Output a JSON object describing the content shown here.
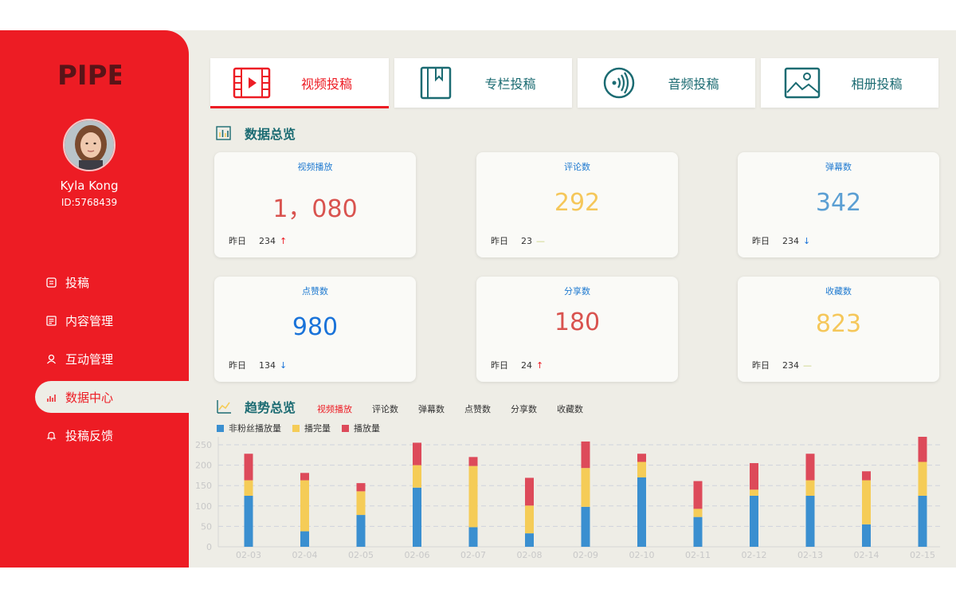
{
  "brand": {
    "logo_text": "PIPE"
  },
  "user": {
    "name": "Kyla Kong",
    "id": "ID:5768439"
  },
  "nav": [
    {
      "label": "投稿",
      "icon": "upload-icon"
    },
    {
      "label": "内容管理",
      "icon": "document-icon"
    },
    {
      "label": "互动管理",
      "icon": "users-icon"
    },
    {
      "label": "数据中心",
      "icon": "chart-icon",
      "active": true
    },
    {
      "label": "投稿反馈",
      "icon": "bell-icon"
    }
  ],
  "tabs": [
    {
      "label": "视频投稿",
      "icon": "film-icon",
      "active": true
    },
    {
      "label": "专栏投稿",
      "icon": "bookmark-book-icon"
    },
    {
      "label": "音频投稿",
      "icon": "audio-icon"
    },
    {
      "label": "相册投稿",
      "icon": "image-icon"
    }
  ],
  "overview": {
    "title": "数据总览",
    "yesterday_label": "昨日",
    "cards": [
      {
        "label": "视频播放",
        "value": "1，080",
        "yesterday": "234",
        "trend": "up",
        "arrow": "↑",
        "color": "#d9534f"
      },
      {
        "label": "评论数",
        "value": "292",
        "yesterday": "23",
        "trend": "flat",
        "arrow": "—",
        "color": "#f5c75a"
      },
      {
        "label": "弹幕数",
        "value": "342",
        "yesterday": "234",
        "trend": "down",
        "arrow": "↓",
        "color": "#5b9fd3"
      },
      {
        "label": "点赞数",
        "value": "980",
        "yesterday": "134",
        "trend": "down",
        "arrow": "↓",
        "color": "#1a73d9"
      },
      {
        "label": "分享数",
        "value": "180",
        "yesterday": "24",
        "trend": "up",
        "arrow": "↑",
        "color": "#d9534f"
      },
      {
        "label": "收藏数",
        "value": "823",
        "yesterday": "234",
        "trend": "flat",
        "arrow": "—",
        "color": "#f5c75a"
      }
    ]
  },
  "trend": {
    "title": "趋势总览",
    "tabs": [
      {
        "label": "视频播放",
        "active": true
      },
      {
        "label": "评论数"
      },
      {
        "label": "弹幕数"
      },
      {
        "label": "点赞数"
      },
      {
        "label": "分享数"
      },
      {
        "label": "收藏数"
      }
    ]
  },
  "chart_data": {
    "type": "bar",
    "stacked": true,
    "categories": [
      "02-03",
      "02-04",
      "02-05",
      "02-06",
      "02-07",
      "02-08",
      "02-09",
      "02-10",
      "02-11",
      "02-12",
      "02-13",
      "02-14",
      "02-15"
    ],
    "series": [
      {
        "name": "非粉丝播放量",
        "color": "#3a8fd0",
        "values": [
          125,
          38,
          78,
          145,
          48,
          33,
          98,
          170,
          73,
          125,
          125,
          55,
          125
        ]
      },
      {
        "name": "播完量",
        "color": "#f5cc57",
        "values": [
          38,
          125,
          58,
          55,
          150,
          68,
          95,
          38,
          20,
          15,
          38,
          108,
          83
        ]
      },
      {
        "name": "播放量",
        "color": "#dd4a5a",
        "values": [
          65,
          18,
          20,
          55,
          22,
          68,
          65,
          20,
          68,
          65,
          65,
          22,
          65
        ]
      }
    ],
    "yticks": [
      0,
      50,
      100,
      150,
      200,
      250
    ],
    "ylim": [
      0,
      250
    ],
    "grid": true,
    "legend_position": "top-left"
  }
}
